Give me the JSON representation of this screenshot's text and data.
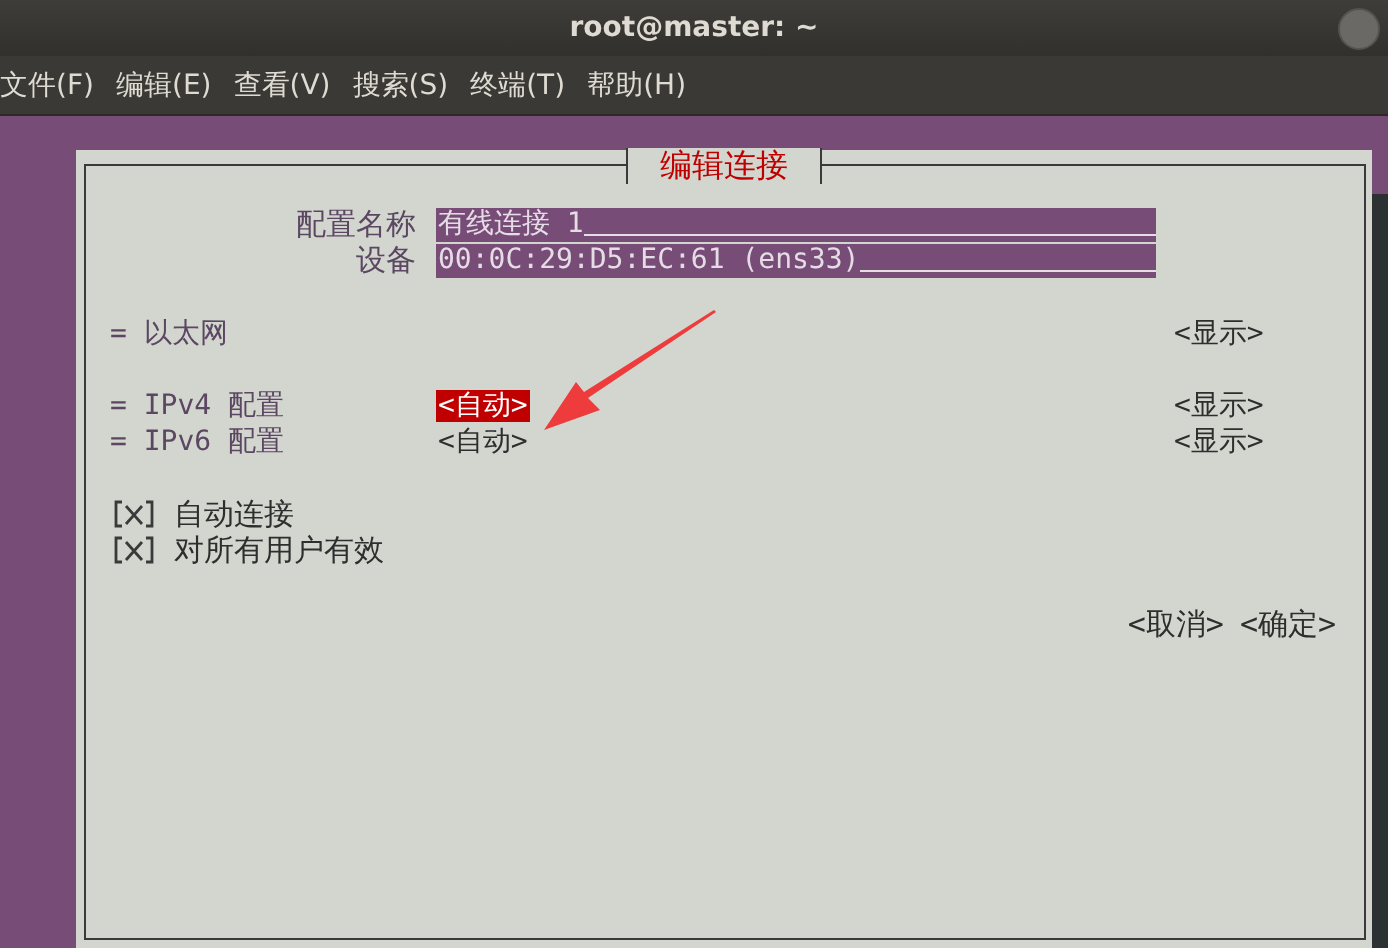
{
  "window": {
    "title": "root@master: ~"
  },
  "menu": [
    "文件(F)",
    "编辑(E)",
    "查看(V)",
    "搜索(S)",
    "终端(T)",
    "帮助(H)"
  ],
  "dialog": {
    "title": "编辑连接",
    "fields": [
      {
        "label": "配置名称",
        "value": "有线连接 1"
      },
      {
        "label": "设备",
        "value": "00:0C:29:D5:EC:61 (ens33)"
      }
    ],
    "sections": [
      {
        "label": "= 以太网",
        "action": "<显示>"
      },
      {
        "label": "= IPv4 配置",
        "value": "<自动>",
        "selected": true,
        "action": "<显示>"
      },
      {
        "label": "= IPv6 配置",
        "value": "<自动>",
        "selected": false,
        "action": "<显示>"
      }
    ],
    "checkboxes": [
      {
        "label": "自动连接",
        "checked": true
      },
      {
        "label": "对所有用户有效",
        "checked": true
      }
    ],
    "buttons": [
      "<取消>",
      "<确定>"
    ]
  }
}
